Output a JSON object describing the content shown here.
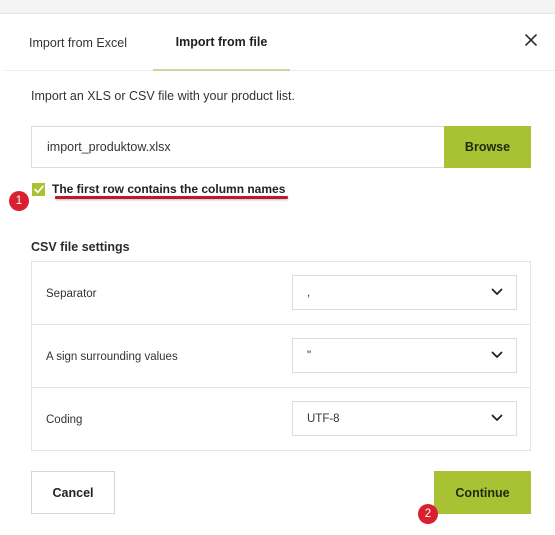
{
  "tabs": [
    {
      "label": "Import from Excel"
    },
    {
      "label": "Import from file"
    }
  ],
  "active_tab": "Import from file",
  "intro_text": "Import an XLS or CSV file with your product list.",
  "file": {
    "value": "import_produktow.xlsx",
    "browse_label": "Browse"
  },
  "header_checkbox": {
    "label": "The first row contains the column names",
    "checked": true
  },
  "csv_settings": {
    "title": "CSV file settings",
    "rows": [
      {
        "label": "Separator",
        "value": ","
      },
      {
        "label": "A sign surrounding values",
        "value": "\""
      },
      {
        "label": "Coding",
        "value": "UTF-8"
      }
    ]
  },
  "footer": {
    "cancel_label": "Cancel",
    "continue_label": "Continue"
  },
  "annotations": {
    "badge1": "1",
    "badge2": "2"
  },
  "icons": {
    "close": "close-icon",
    "chevron": "chevron-down-icon",
    "check": "checkmark-icon"
  },
  "colors": {
    "accent": "#a9c233",
    "annotation_red": "#d9202e",
    "underline_red": "#c0172b"
  }
}
